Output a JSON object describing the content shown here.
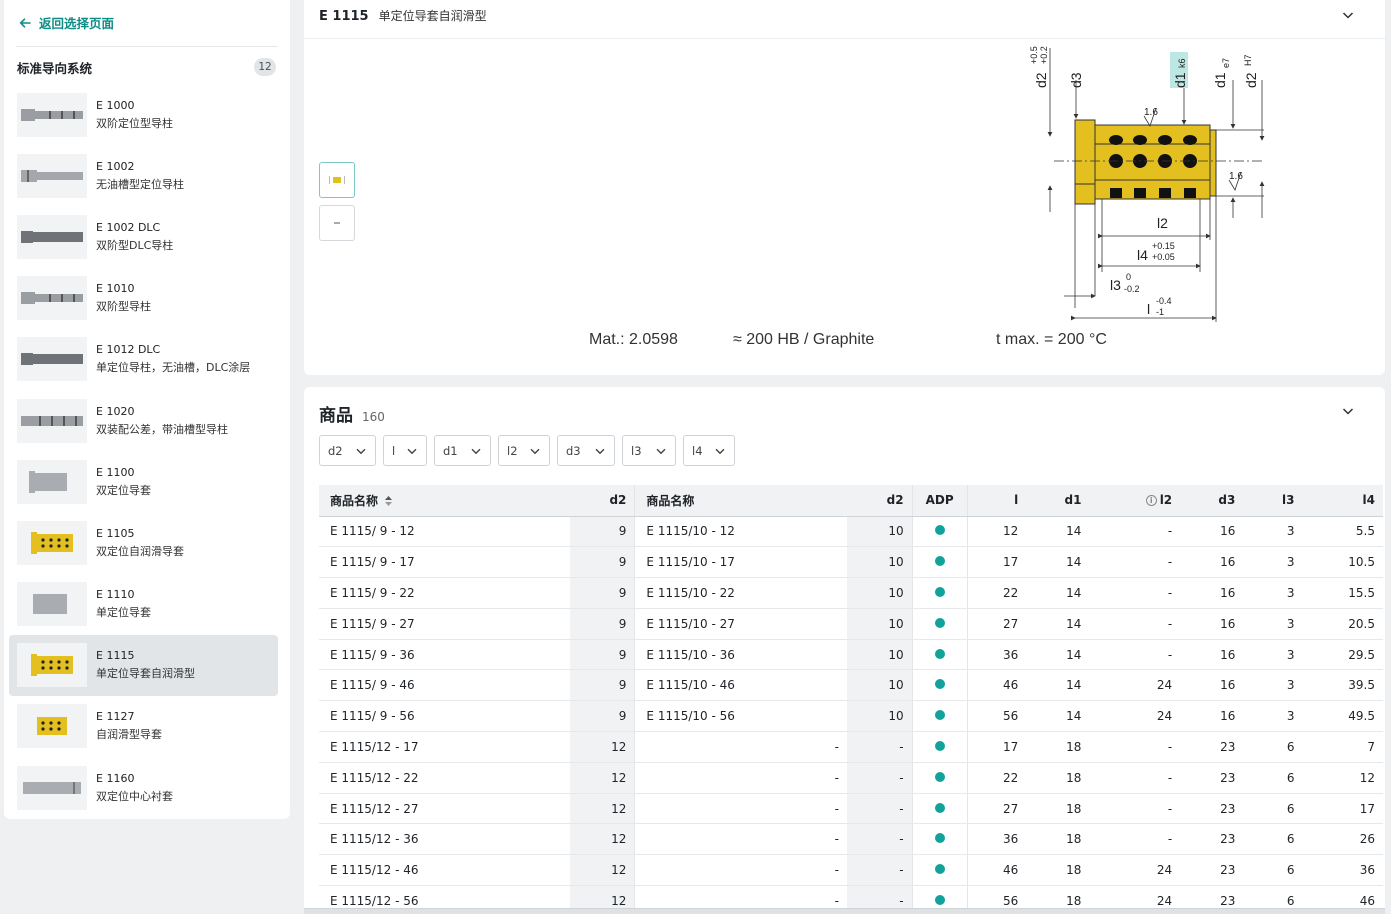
{
  "sidebar": {
    "back_label": "返回选择页面",
    "category": {
      "title": "标准导向系统",
      "count": "12"
    },
    "items": [
      {
        "code": "E 1000",
        "name": "双阶定位型导柱",
        "icon": "pillar-stepped",
        "color": "#9a9da1"
      },
      {
        "code": "E 1002",
        "name": "无油槽型定位导柱",
        "icon": "pillar-plain",
        "color": "#a4a7ab"
      },
      {
        "code": "E 1002 DLC",
        "name": "双阶型DLC导柱",
        "icon": "pillar-dlc",
        "color": "#6f7378"
      },
      {
        "code": "E 1010",
        "name": "双阶型导柱",
        "icon": "pillar-stepped",
        "color": "#9a9da1"
      },
      {
        "code": "E 1012 DLC",
        "name": "单定位导柱，无油槽，DLC涂层",
        "icon": "pillar-dlc",
        "color": "#6f7378"
      },
      {
        "code": "E 1020",
        "name": "双装配公差，带油槽型导柱",
        "icon": "pillar-grooved",
        "color": "#9a9da1"
      },
      {
        "code": "E 1100",
        "name": "双定位导套",
        "icon": "bush-collar",
        "color": "#a9acb0"
      },
      {
        "code": "E 1105",
        "name": "双定位自润滑导套",
        "icon": "bush-graphite",
        "color": "#e3bf1f"
      },
      {
        "code": "E 1110",
        "name": "单定位导套",
        "icon": "bush-plain",
        "color": "#a9acb0"
      },
      {
        "code": "E 1115",
        "name": "单定位导套自润滑型",
        "icon": "bush-graphite",
        "color": "#e3bf1f",
        "active": true
      },
      {
        "code": "E 1127",
        "name": "自润滑型导套",
        "icon": "bush-graphite-short",
        "color": "#e3bf1f"
      },
      {
        "code": "E 1160",
        "name": "双定位中心衬套",
        "icon": "bush-sleeve",
        "color": "#a9acb0"
      }
    ]
  },
  "detail": {
    "code": "E 1115",
    "name": "单定位导套自润滑型",
    "material": "Mat.: 2.0598",
    "hardness": "≈ 200 HB / Graphite",
    "tmax": "t max. = 200 °C",
    "drawing_labels": {
      "d2_tol": "d2",
      "d2_tol_upper": "+0.5",
      "d2_tol_lower": "+0.2",
      "d3": "d3",
      "d1k6": "d1",
      "d1k6_fit": "k6",
      "d1e7": "d1",
      "d1e7_fit": "e7",
      "d2H7": "d2",
      "d2H7_fit": "H7",
      "rough1": "1.6",
      "rough2": "1.6",
      "l2": "l2",
      "l4": "l4",
      "l4_upper": "+0.15",
      "l4_lower": "+0.05",
      "l3": "l3",
      "l3_upper": "0",
      "l3_lower": "-0.2",
      "l": "l",
      "l_upper": "-0.4",
      "l_lower": "-1"
    }
  },
  "products": {
    "title": "商品",
    "count": "160",
    "filters": [
      "d2",
      "l",
      "d1",
      "l2",
      "d3",
      "l3",
      "l4"
    ],
    "columns": [
      "商品名称",
      "d2",
      "商品名称",
      "d2",
      "ADP",
      "l",
      "d1",
      "l2",
      "d3",
      "l3",
      "l4"
    ],
    "rows": [
      {
        "name": "E 1115/ 9 - 12",
        "d2": "9",
        "name2": "E 1115/10 - 12",
        "d2b": "10",
        "adp": true,
        "l": "12",
        "d1": "14",
        "l2": "-",
        "d3": "16",
        "l3": "3",
        "l4": "5.5"
      },
      {
        "name": "E 1115/ 9 - 17",
        "d2": "9",
        "name2": "E 1115/10 - 17",
        "d2b": "10",
        "adp": true,
        "l": "17",
        "d1": "14",
        "l2": "-",
        "d3": "16",
        "l3": "3",
        "l4": "10.5"
      },
      {
        "name": "E 1115/ 9 - 22",
        "d2": "9",
        "name2": "E 1115/10 - 22",
        "d2b": "10",
        "adp": true,
        "l": "22",
        "d1": "14",
        "l2": "-",
        "d3": "16",
        "l3": "3",
        "l4": "15.5"
      },
      {
        "name": "E 1115/ 9 - 27",
        "d2": "9",
        "name2": "E 1115/10 - 27",
        "d2b": "10",
        "adp": true,
        "l": "27",
        "d1": "14",
        "l2": "-",
        "d3": "16",
        "l3": "3",
        "l4": "20.5"
      },
      {
        "name": "E 1115/ 9 - 36",
        "d2": "9",
        "name2": "E 1115/10 - 36",
        "d2b": "10",
        "adp": true,
        "l": "36",
        "d1": "14",
        "l2": "-",
        "d3": "16",
        "l3": "3",
        "l4": "29.5"
      },
      {
        "name": "E 1115/ 9 - 46",
        "d2": "9",
        "name2": "E 1115/10 - 46",
        "d2b": "10",
        "adp": true,
        "l": "46",
        "d1": "14",
        "l2": "24",
        "d3": "16",
        "l3": "3",
        "l4": "39.5"
      },
      {
        "name": "E 1115/ 9 - 56",
        "d2": "9",
        "name2": "E 1115/10 - 56",
        "d2b": "10",
        "adp": true,
        "l": "56",
        "d1": "14",
        "l2": "24",
        "d3": "16",
        "l3": "3",
        "l4": "49.5"
      },
      {
        "name": "E 1115/12 - 17",
        "d2": "12",
        "name2": "-",
        "d2b": "-",
        "adp": true,
        "l": "17",
        "d1": "18",
        "l2": "-",
        "d3": "23",
        "l3": "6",
        "l4": "7"
      },
      {
        "name": "E 1115/12 - 22",
        "d2": "12",
        "name2": "-",
        "d2b": "-",
        "adp": true,
        "l": "22",
        "d1": "18",
        "l2": "-",
        "d3": "23",
        "l3": "6",
        "l4": "12"
      },
      {
        "name": "E 1115/12 - 27",
        "d2": "12",
        "name2": "-",
        "d2b": "-",
        "adp": true,
        "l": "27",
        "d1": "18",
        "l2": "-",
        "d3": "23",
        "l3": "6",
        "l4": "17"
      },
      {
        "name": "E 1115/12 - 36",
        "d2": "12",
        "name2": "-",
        "d2b": "-",
        "adp": true,
        "l": "36",
        "d1": "18",
        "l2": "-",
        "d3": "23",
        "l3": "6",
        "l4": "26"
      },
      {
        "name": "E 1115/12 - 46",
        "d2": "12",
        "name2": "-",
        "d2b": "-",
        "adp": true,
        "l": "46",
        "d1": "18",
        "l2": "24",
        "d3": "23",
        "l3": "6",
        "l4": "36"
      },
      {
        "name": "E 1115/12 - 56",
        "d2": "12",
        "name2": "-",
        "d2b": "-",
        "adp": true,
        "l": "56",
        "d1": "18",
        "l2": "24",
        "d3": "23",
        "l3": "6",
        "l4": "46"
      }
    ]
  },
  "colors": {
    "accent": "#0e8c86",
    "adp_dot": "#11a39b",
    "brass": "#e3bf1f",
    "selected_bg": "#e2e5e8"
  }
}
